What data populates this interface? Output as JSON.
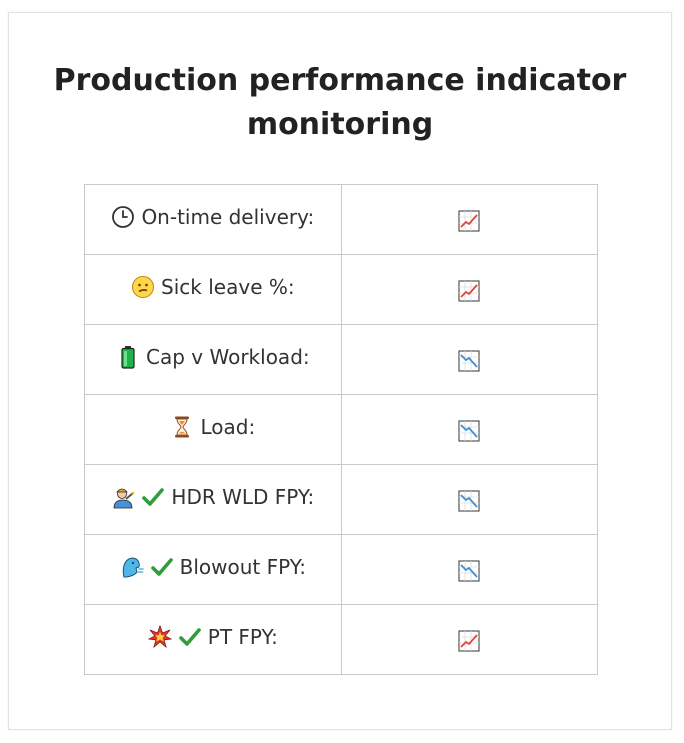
{
  "title": "Production performance indicator monitoring",
  "rows": [
    {
      "icons": [
        "clock-icon"
      ],
      "label": "On-time delivery:",
      "trend": "chart-increasing-icon"
    },
    {
      "icons": [
        "confused-face-icon"
      ],
      "label": "Sick leave %:",
      "trend": "chart-increasing-icon"
    },
    {
      "icons": [
        "battery-icon"
      ],
      "label": "Cap v Workload:",
      "trend": "chart-decreasing-icon"
    },
    {
      "icons": [
        "hourglass-icon"
      ],
      "label": "Load:",
      "trend": "chart-decreasing-icon"
    },
    {
      "icons": [
        "factory-worker-icon",
        "check-mark-icon"
      ],
      "label": "HDR WLD FPY:",
      "trend": "chart-decreasing-icon"
    },
    {
      "icons": [
        "blowing-face-icon",
        "check-mark-icon"
      ],
      "label": "Blowout FPY:",
      "trend": "chart-decreasing-icon"
    },
    {
      "icons": [
        "collision-icon",
        "check-mark-icon"
      ],
      "label": "PT FPY:",
      "trend": "chart-increasing-icon"
    }
  ],
  "colors": {
    "increasing": "#e0453a",
    "decreasing": "#3b8fd6",
    "check": "#2e9d3a"
  }
}
